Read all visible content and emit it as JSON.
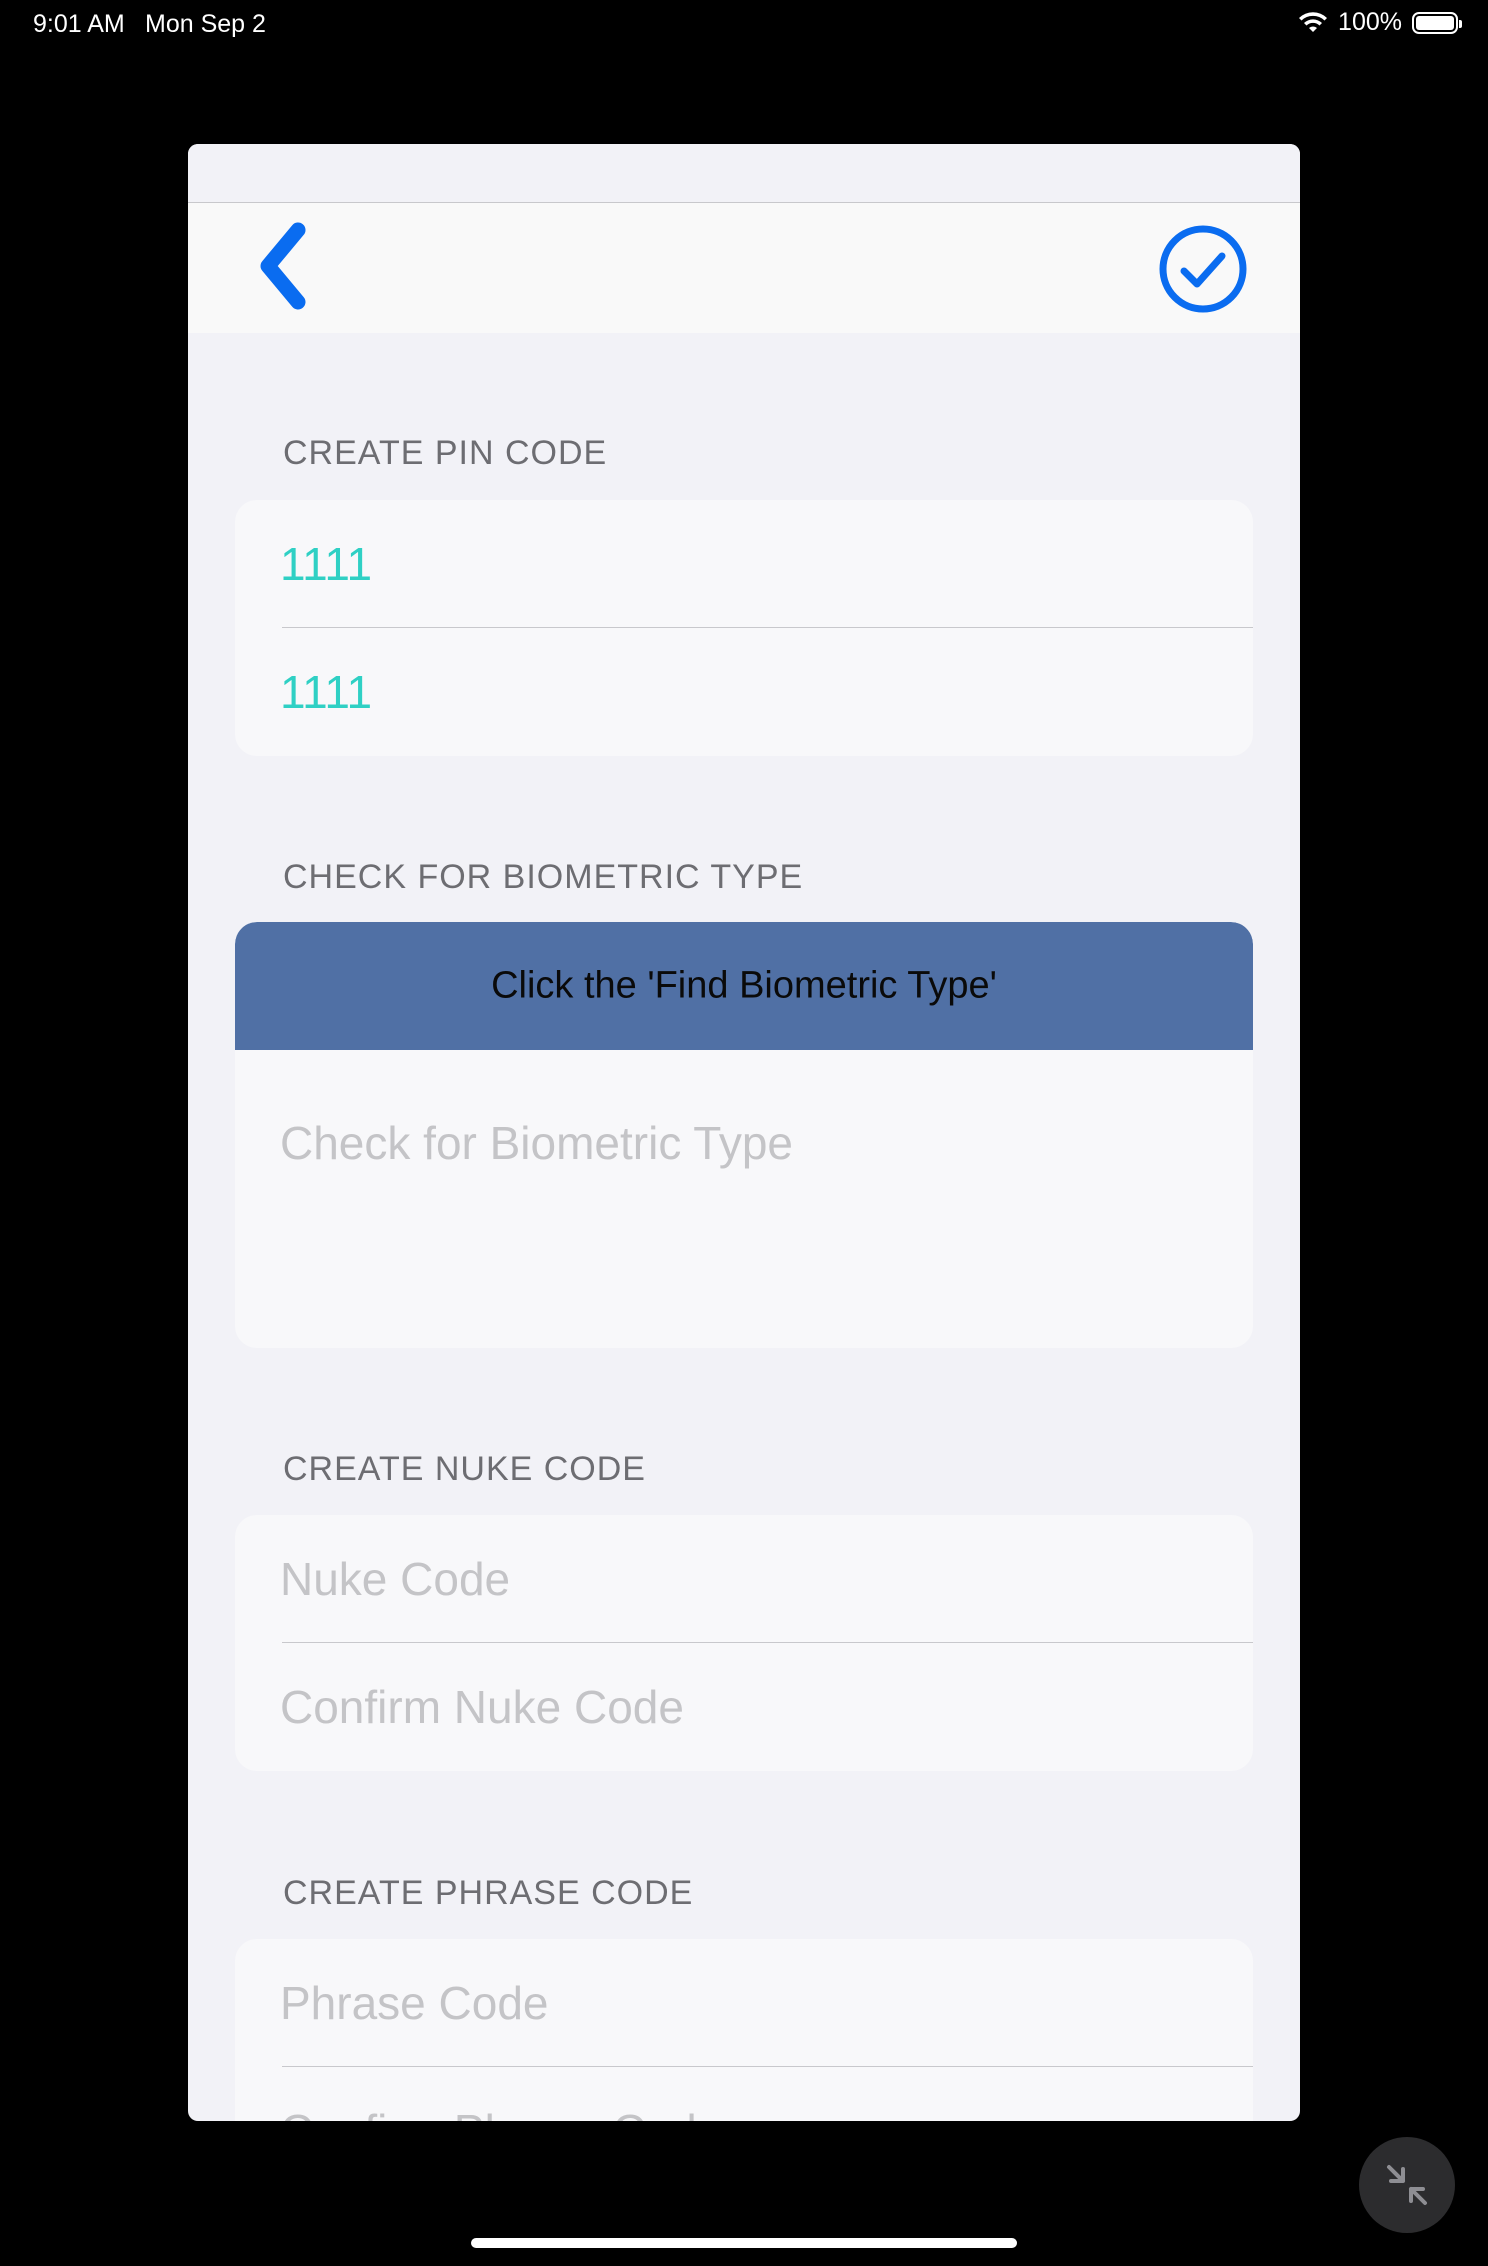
{
  "status": {
    "time": "9:01 AM",
    "date": "Mon Sep 2",
    "battery": "100%"
  },
  "nav": {
    "back_icon": "chevron-left-icon",
    "confirm_icon": "checkmark-circle-icon",
    "accent": "#0a6cf0"
  },
  "pin": {
    "header": "CREATE PIN CODE",
    "value": "1111",
    "confirm_value": "1111"
  },
  "biometric": {
    "header": "CHECK FOR BIOMETRIC TYPE",
    "button_label": "Click the 'Find Biometric Type'",
    "placeholder": "Check for Biometric Type"
  },
  "nuke": {
    "header": "CREATE NUKE CODE",
    "placeholder": "Nuke Code",
    "confirm_placeholder": "Confirm Nuke Code"
  },
  "phrase": {
    "header": "CREATE PHRASE CODE",
    "placeholder": "Phrase Code",
    "confirm_placeholder": "Confirm Phrase Code"
  },
  "colors": {
    "value_text": "#2fd0c4",
    "button_bg": "#5070a5",
    "placeholder": "#c4c4c7"
  }
}
